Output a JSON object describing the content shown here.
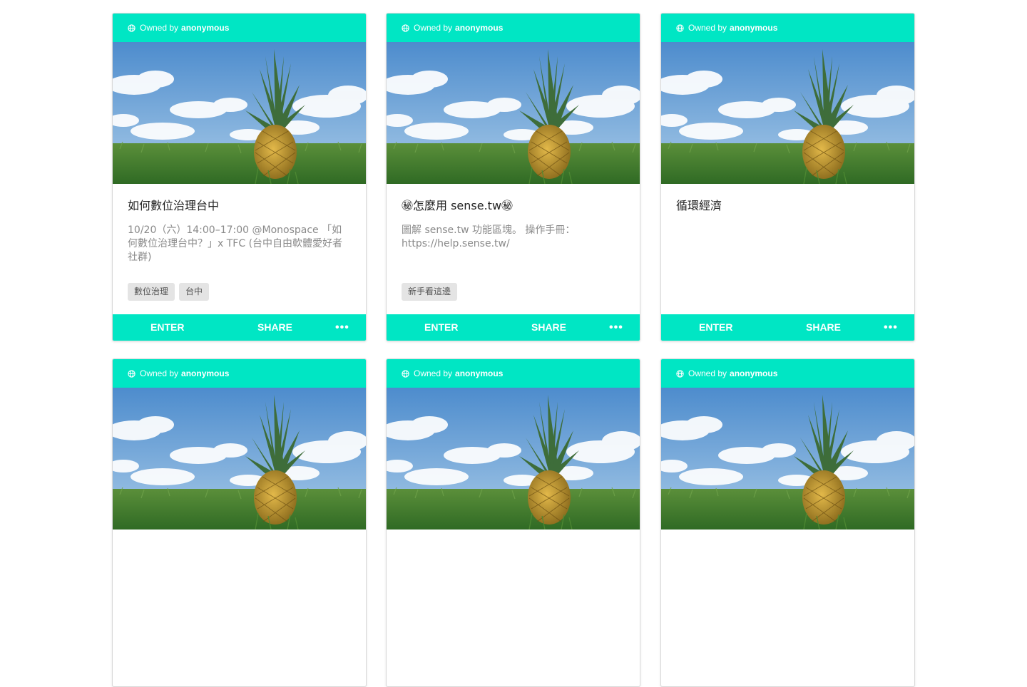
{
  "owner_prefix": "Owned by",
  "cards": [
    {
      "owner": "anonymous",
      "title": "如何數位治理台中",
      "description": "10/20（六）14:00–17:00 @Monospace 「如何數位治理台中？」x TFC (台中自由軟體愛好者社群)",
      "tags": [
        "數位治理",
        "台中"
      ],
      "enter_label": "ENTER",
      "share_label": "SHARE",
      "more_label": "•••"
    },
    {
      "owner": "anonymous",
      "title": "㊙怎麼用 sense.tw㊙",
      "description": "圖解 sense.tw 功能區塊。 操作手冊：https://help.sense.tw/",
      "tags": [
        "新手看這邊"
      ],
      "enter_label": "ENTER",
      "share_label": "SHARE",
      "more_label": "•••"
    },
    {
      "owner": "anonymous",
      "title": "循環經濟",
      "description": "",
      "tags": [],
      "enter_label": "ENTER",
      "share_label": "SHARE",
      "more_label": "•••"
    },
    {
      "owner": "anonymous"
    },
    {
      "owner": "anonymous"
    },
    {
      "owner": "anonymous"
    }
  ],
  "colors": {
    "accent": "#00e6c4",
    "sky": "#6aa3d8",
    "grass": "#3f7a2e"
  }
}
